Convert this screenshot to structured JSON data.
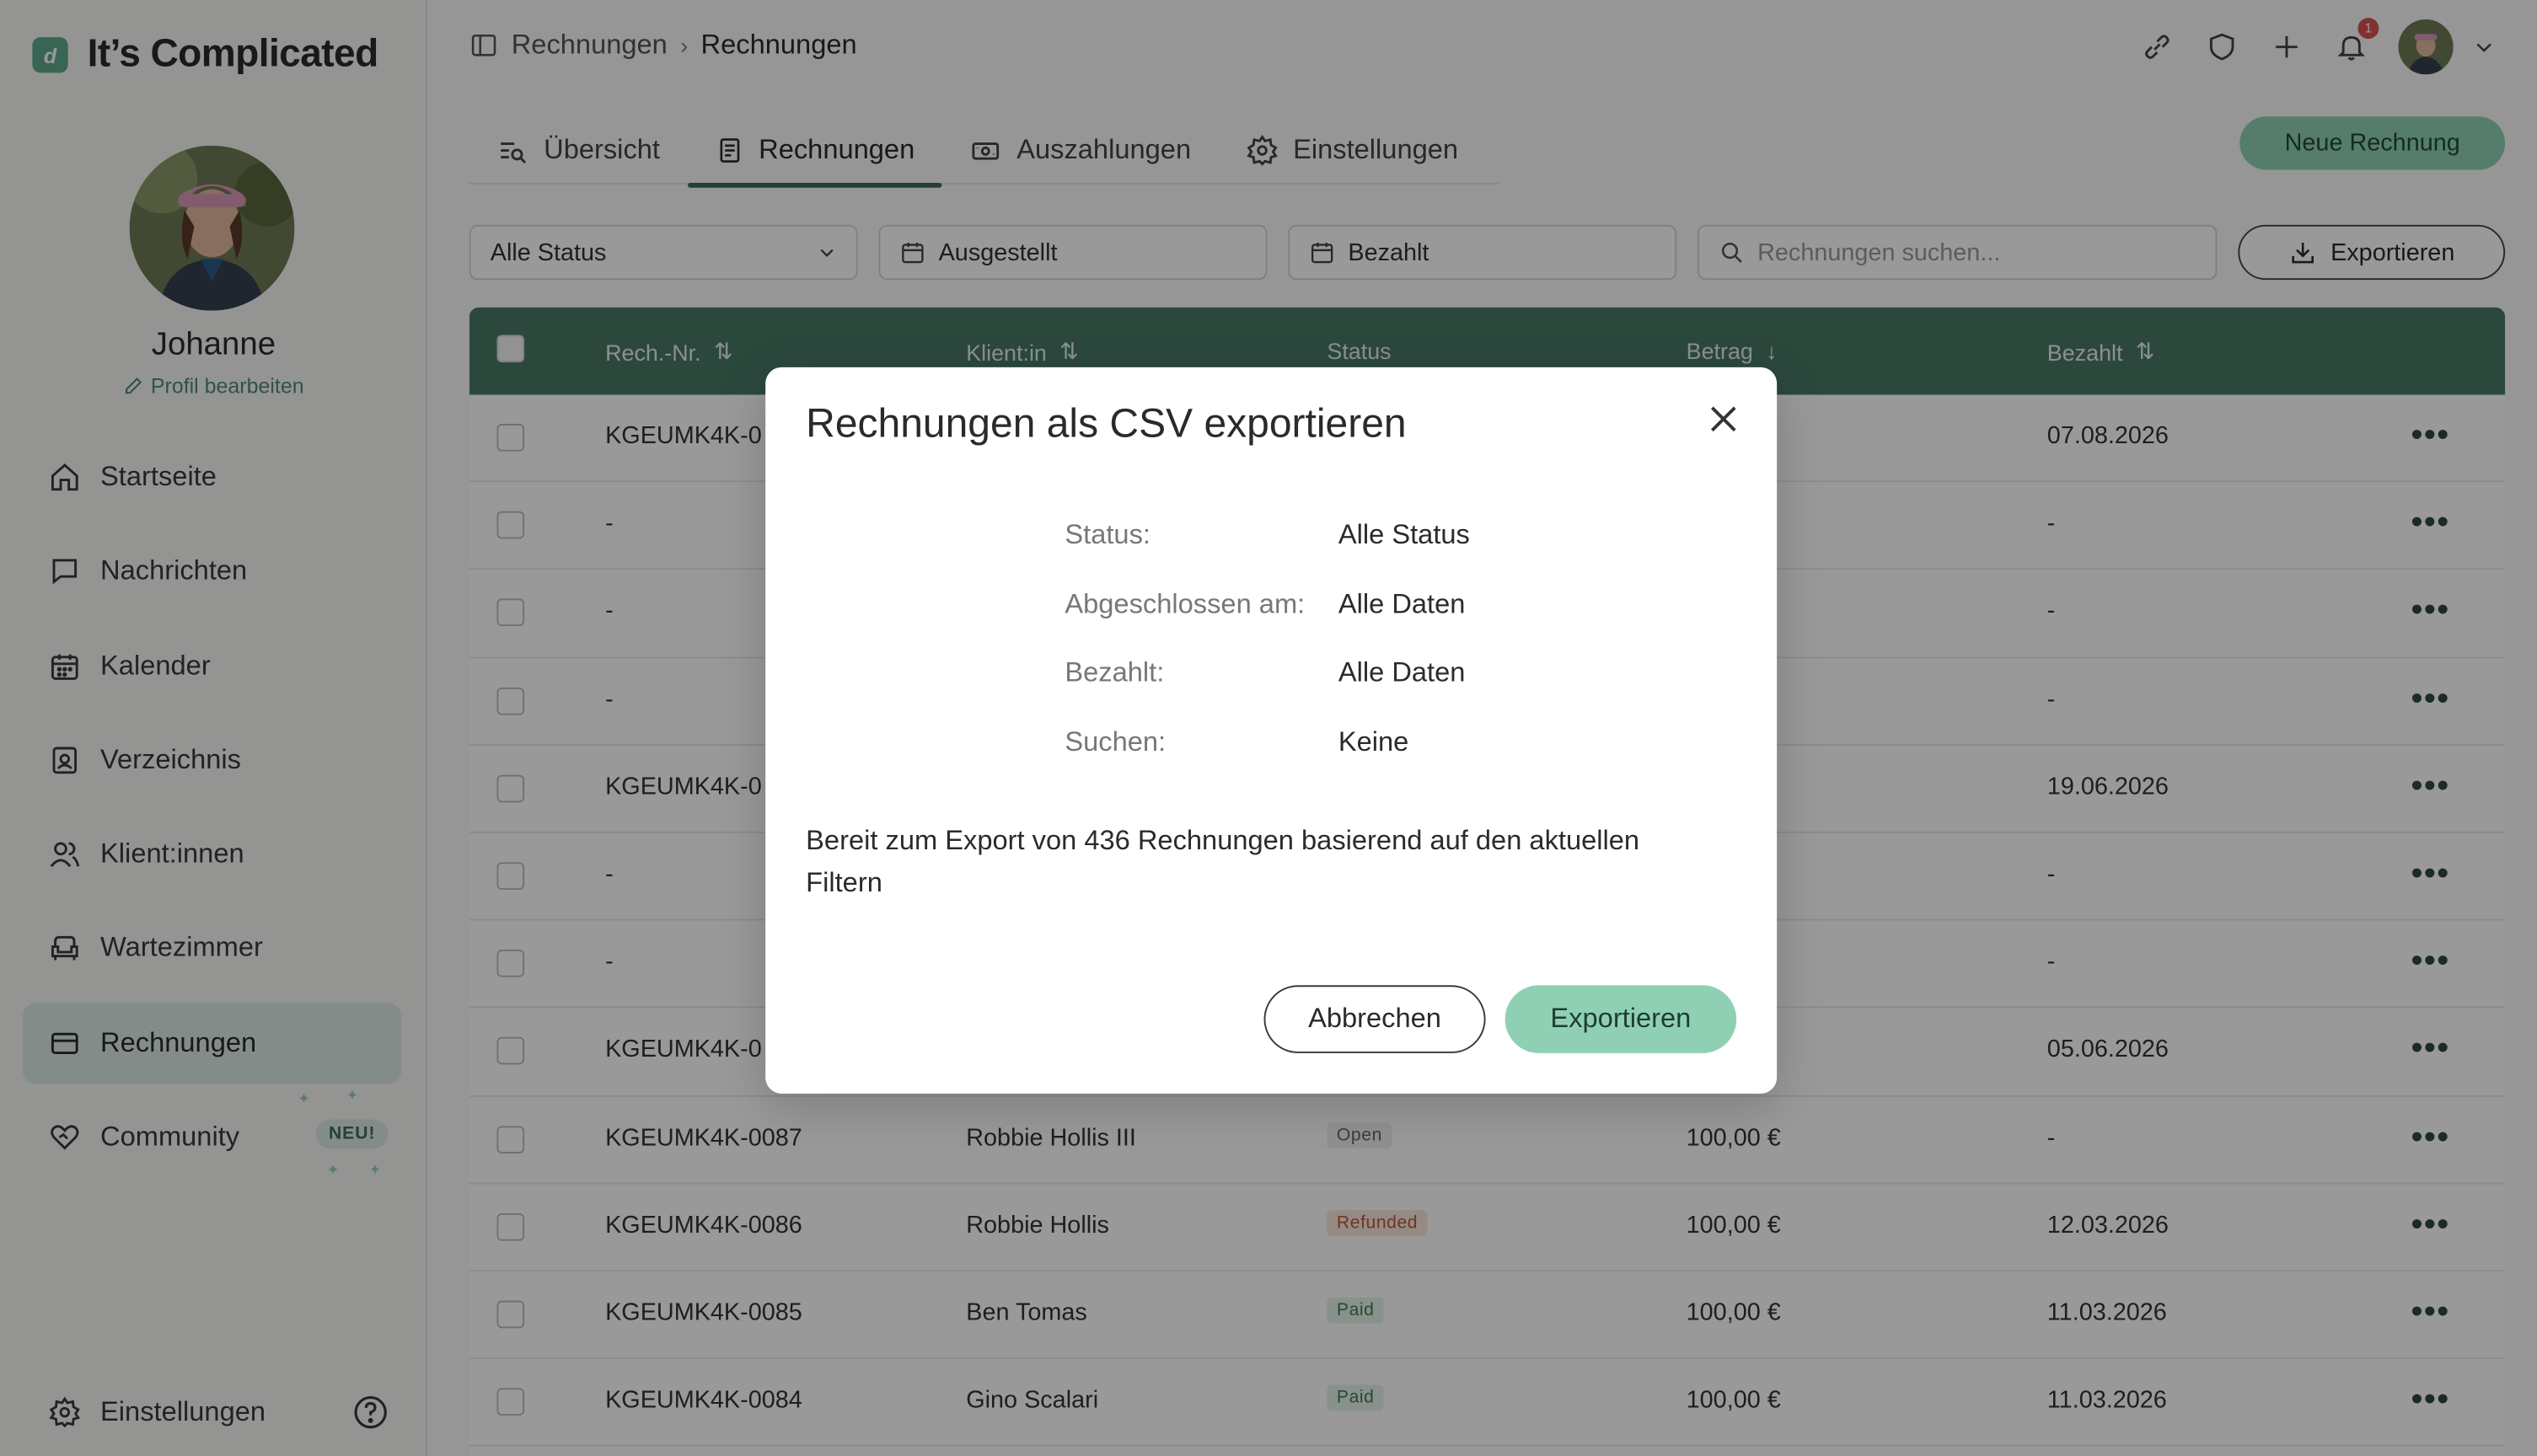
{
  "app": {
    "name": "It’s Complicated",
    "logo_letter": "d"
  },
  "profile": {
    "name": "Johanne",
    "edit_label": "Profil bearbeiten"
  },
  "sidebar": {
    "items": [
      {
        "label": "Startseite",
        "icon": "home-icon"
      },
      {
        "label": "Nachrichten",
        "icon": "chat-icon"
      },
      {
        "label": "Kalender",
        "icon": "calendar-icon"
      },
      {
        "label": "Verzeichnis",
        "icon": "directory-icon"
      },
      {
        "label": "Klient:innen",
        "icon": "clients-icon"
      },
      {
        "label": "Wartezimmer",
        "icon": "armchair-icon"
      },
      {
        "label": "Rechnungen",
        "icon": "card-icon",
        "active": true
      },
      {
        "label": "Community",
        "icon": "heart-icon",
        "badge": "NEU!"
      }
    ],
    "settings_label": "Einstellungen"
  },
  "breadcrumb": {
    "parent": "Rechnungen",
    "current": "Rechnungen"
  },
  "notifications": {
    "count": "1"
  },
  "tabs": [
    {
      "label": "Übersicht"
    },
    {
      "label": "Rechnungen",
      "active": true
    },
    {
      "label": "Auszahlungen"
    },
    {
      "label": "Einstellungen"
    }
  ],
  "new_invoice_label": "Neue Rechnung",
  "filters": {
    "status": "Alle Status",
    "issued": "Ausgestellt",
    "paid": "Bezahlt",
    "search_placeholder": "Rechnungen suchen...",
    "export_label": "Exportieren"
  },
  "table": {
    "headers": {
      "number": "Rech.-Nr.",
      "client": "Klient:in",
      "status": "Status",
      "amount": "Betrag",
      "paid": "Bezahlt"
    },
    "rows": [
      {
        "number": "KGEUMK4K-0",
        "client": "",
        "status": "",
        "amount": "€",
        "paid": "07.08.2026"
      },
      {
        "number": "-",
        "client": "",
        "status": "",
        "amount": "",
        "paid": "-"
      },
      {
        "number": "-",
        "client": "",
        "status": "",
        "amount": "",
        "paid": "-"
      },
      {
        "number": "-",
        "client": "",
        "status": "",
        "amount": "",
        "paid": "-"
      },
      {
        "number": "KGEUMK4K-0",
        "client": "",
        "status": "",
        "amount": "€",
        "paid": "19.06.2026"
      },
      {
        "number": "-",
        "client": "",
        "status": "",
        "amount": "",
        "paid": "-"
      },
      {
        "number": "-",
        "client": "",
        "status": "",
        "amount": "",
        "paid": "-"
      },
      {
        "number": "KGEUMK4K-0",
        "client": "",
        "status": "",
        "amount": "€",
        "paid": "05.06.2026"
      },
      {
        "number": "KGEUMK4K-0087",
        "client": "Robbie Hollis III",
        "status": "Open",
        "amount": "100,00 €",
        "paid": "-"
      },
      {
        "number": "KGEUMK4K-0086",
        "client": "Robbie Hollis",
        "status": "Refunded",
        "amount": "100,00 €",
        "paid": "12.03.2026"
      },
      {
        "number": "KGEUMK4K-0085",
        "client": "Ben Tomas",
        "status": "Paid",
        "amount": "100,00 €",
        "paid": "11.03.2026"
      },
      {
        "number": "KGEUMK4K-0084",
        "client": "Gino Scalari",
        "status": "Paid",
        "amount": "100,00 €",
        "paid": "11.03.2026"
      }
    ],
    "row_menu": "•••"
  },
  "modal": {
    "title": "Rechnungen als CSV exportieren",
    "details": [
      {
        "key": "Status:",
        "value": "Alle Status"
      },
      {
        "key": "Abgeschlossen am:",
        "value": "Alle Daten"
      },
      {
        "key": "Bezahlt:",
        "value": "Alle Daten"
      },
      {
        "key": "Suchen:",
        "value": "Keine"
      }
    ],
    "message": "Bereit zum Export von 436 Rechnungen basierend auf den aktuellen Filtern",
    "cancel_label": "Abbrechen",
    "export_label": "Exportieren"
  },
  "colors": {
    "accent": "#8fd0b5",
    "header": "#4a7867",
    "active_nav": "#dce9e4"
  }
}
